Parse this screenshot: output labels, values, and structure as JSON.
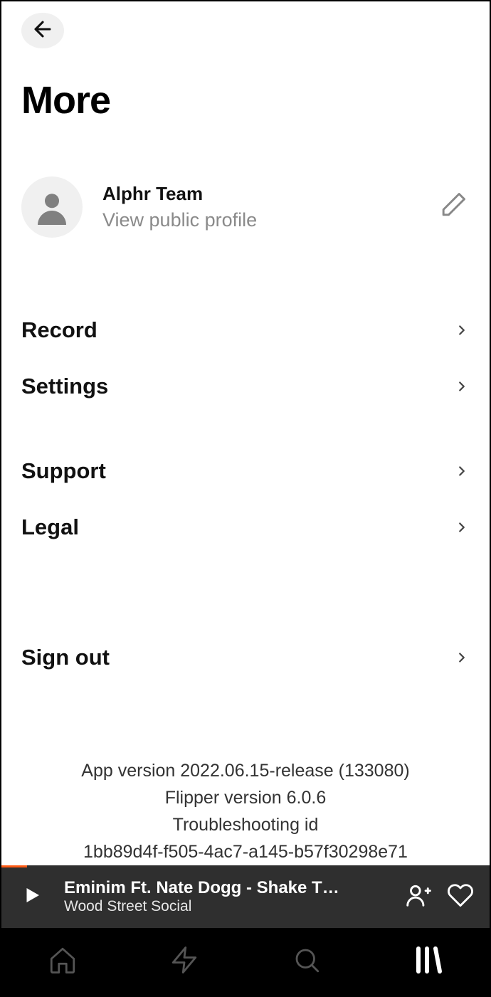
{
  "header": {
    "title": "More"
  },
  "profile": {
    "name": "Alphr Team",
    "subtitle": "View public profile"
  },
  "menu": {
    "record": "Record",
    "settings": "Settings",
    "support": "Support",
    "legal": "Legal",
    "signout": "Sign out"
  },
  "versions": {
    "line1": "App version 2022.06.15-release (133080)",
    "line2": "Flipper version 6.0.6",
    "line3": "Troubleshooting id",
    "line4": "1bb89d4f-f505-4ac7-a145-b57f30298e71"
  },
  "nowplaying": {
    "title": "Eminim Ft. Nate Dogg - Shake T…",
    "artist": "Wood Street Social"
  }
}
